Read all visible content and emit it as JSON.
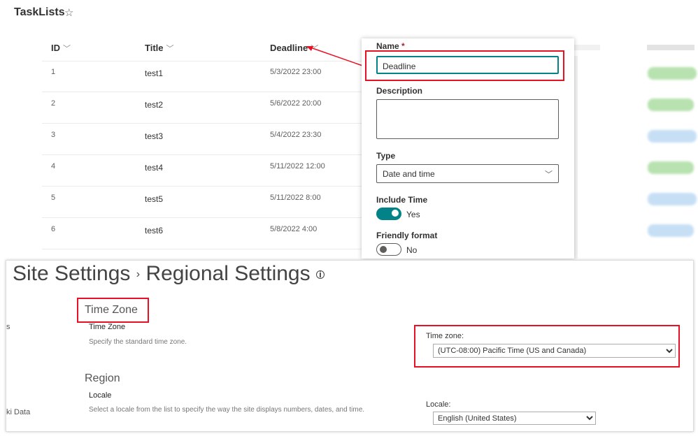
{
  "list": {
    "title": "TaskLists",
    "star_icon": "star-outline-icon",
    "columns": [
      "ID",
      "Title",
      "Deadline"
    ],
    "rows": [
      {
        "id": "1",
        "title": "test1",
        "deadline": "5/3/2022 23:00"
      },
      {
        "id": "2",
        "title": "test2",
        "deadline": "5/6/2022 20:00"
      },
      {
        "id": "3",
        "title": "test3",
        "deadline": "5/4/2022 23:30"
      },
      {
        "id": "4",
        "title": "test4",
        "deadline": "5/11/2022 12:00"
      },
      {
        "id": "5",
        "title": "test5",
        "deadline": "5/11/2022 8:00"
      },
      {
        "id": "6",
        "title": "test6",
        "deadline": "5/8/2022 4:00"
      }
    ],
    "badge_colors": [
      "#b8e2b0",
      "#b8e2b0",
      "#c7dff5",
      "#b8e2b0",
      "#c7dff5",
      "#c7dff5"
    ]
  },
  "column_panel": {
    "name_label": "Name",
    "required_mark": "*",
    "name_value": "Deadline",
    "description_label": "Description",
    "description_value": "",
    "type_label": "Type",
    "type_value": "Date and time",
    "include_time_label": "Include Time",
    "include_time_state": "Yes",
    "friendly_label": "Friendly format",
    "friendly_state": "No",
    "accent": "#038387"
  },
  "regional": {
    "breadcrumb_1": "Site Settings",
    "separator": "›",
    "breadcrumb_2": "Regional Settings",
    "timezone_heading": "Time Zone",
    "timezone_label": "Time Zone",
    "timezone_desc": "Specify the standard time zone.",
    "timezone_field_label": "Time zone:",
    "timezone_value": "(UTC-08:00) Pacific Time (US and Canada)",
    "region_heading": "Region",
    "locale_label": "Locale",
    "locale_desc": "Select a locale from the list to specify the way the site displays numbers, dates, and time.",
    "locale_field_label": "Locale:",
    "locale_value": "English (United States)",
    "left_nav_1": "s",
    "left_nav_2": "ki Data"
  },
  "annotation_color": "#e81123"
}
